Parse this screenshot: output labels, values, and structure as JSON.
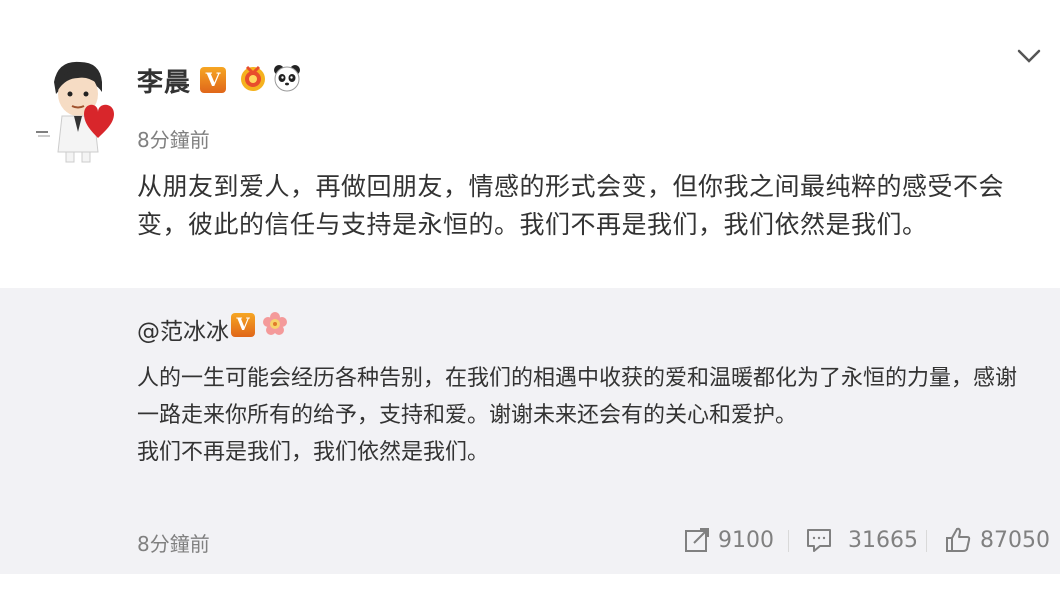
{
  "post": {
    "author": "李晨",
    "verified_badge": "V",
    "time": "8分鐘前",
    "content": "从朋友到爱人，再做回朋友，情感的形式会变，但你我之间最纯粹的感受不会变，彼此的信任与支持是永恒的。我们不再是我们，我们依然是我们。"
  },
  "repost": {
    "author": "@范冰冰",
    "verified_badge": "V",
    "paragraph1": "人的一生可能会经历各种告别，在我们的相遇中收获的爱和温暖都化为了永恒的力量，感谢一路走来你所有的给予，支持和爱。谢谢未来还会有的关心和爱护。",
    "paragraph2": "我们不再是我们，我们依然是我们。",
    "time": "8分鐘前",
    "actions": {
      "repost_count": "9100",
      "comment_count": "31665",
      "like_count": "87050"
    }
  },
  "icons": {
    "menu": "chevron-down-icon",
    "repost": "share-icon",
    "comment": "comment-icon",
    "like": "thumbs-up-icon"
  },
  "colors": {
    "badge": "#f08a1c",
    "repost_background": "#f2f2f5",
    "muted_text": "#808080"
  }
}
